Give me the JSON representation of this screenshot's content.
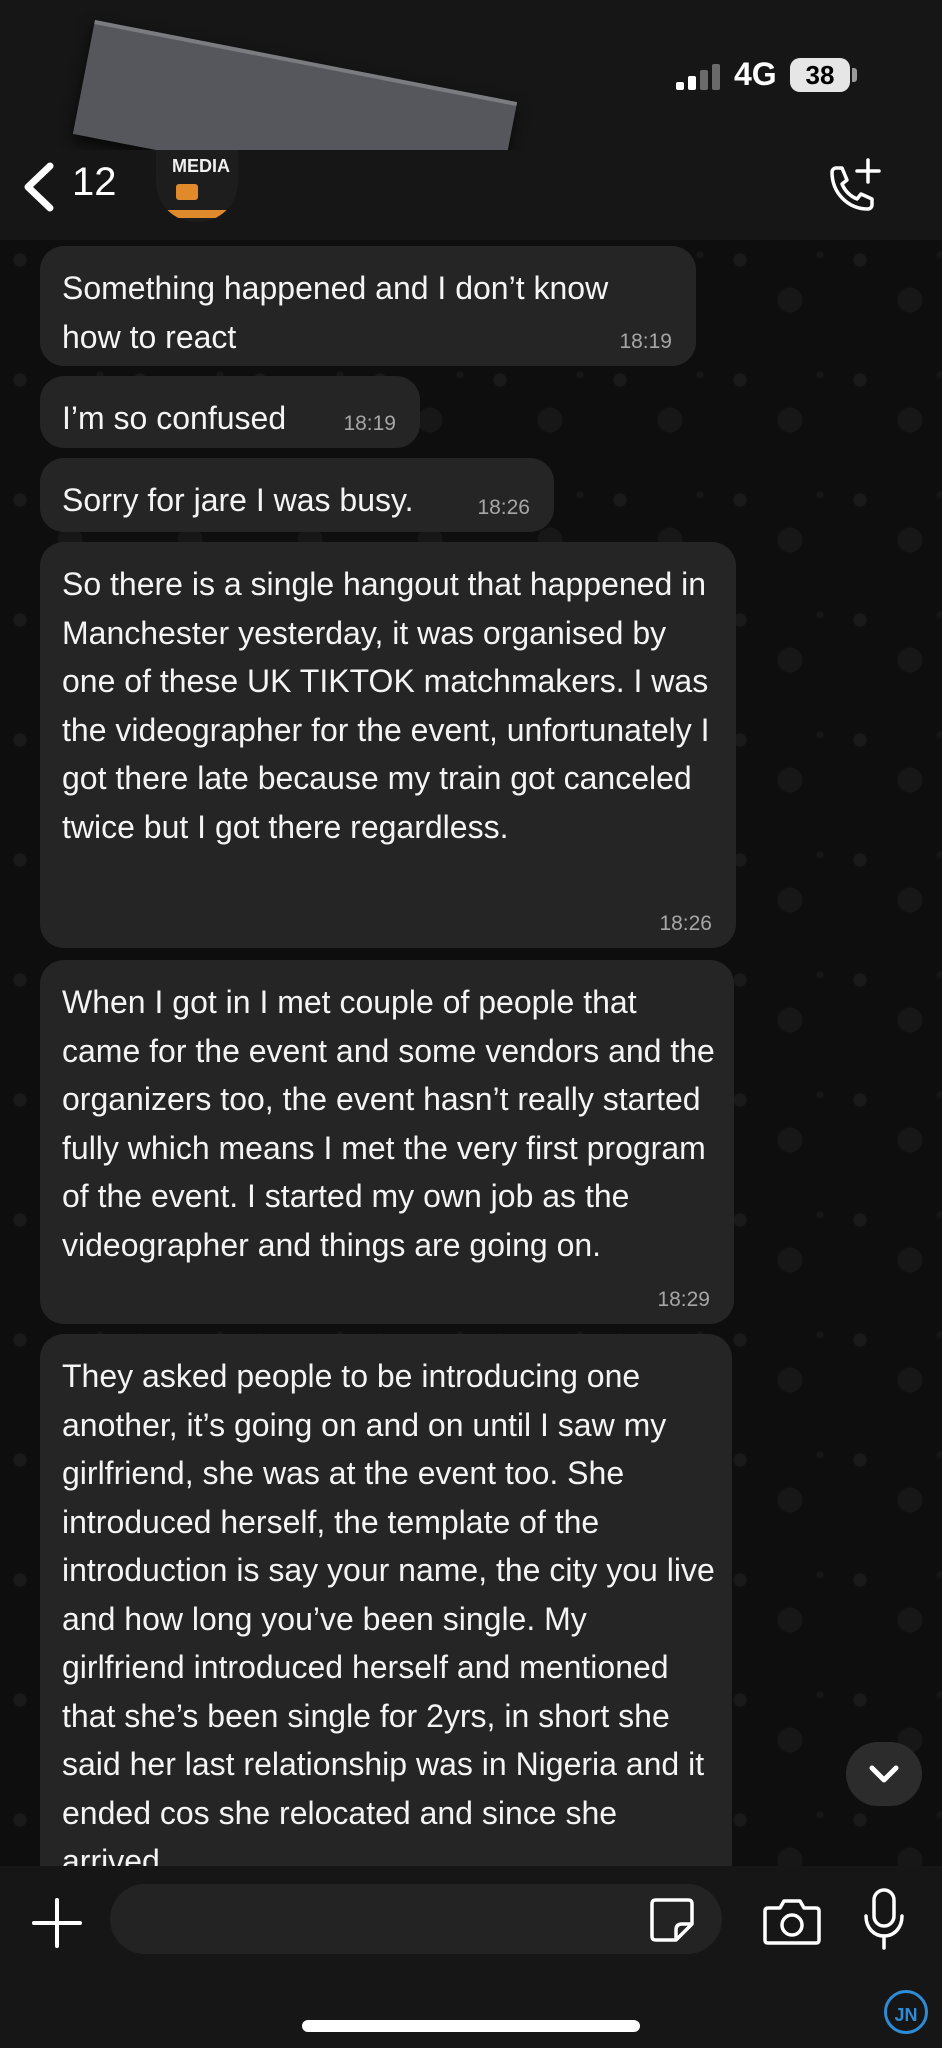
{
  "status_bar": {
    "network": "4G",
    "battery": "38"
  },
  "header": {
    "unread_count": "12",
    "avatar_text": "MEDIA"
  },
  "messages": [
    {
      "text": "Something happened and I don’t know how to react",
      "time": "18:19"
    },
    {
      "text": "I’m so confused",
      "time": "18:19"
    },
    {
      "text": "Sorry for jare I was busy.",
      "time": "18:26"
    },
    {
      "text": "So there is a single hangout that happened in Manchester yesterday, it was organised by one of these UK TIKTOK matchmakers. I was the videographer for the event, unfortunately I got there late because my train got canceled twice but I got there regardless.",
      "time": "18:26"
    },
    {
      "text": "When I got in I met couple of people that came for the event and some vendors and the organizers too, the event hasn’t really started fully which means I met the very first program of the event. I started my own job as the  videographer and things are going on.",
      "time": "18:29"
    },
    {
      "text": "They asked people to be introducing one another, it’s going on and on until I saw my girlfriend, she was at the event too. She introduced herself, the template of the introduction is say your name, the city you live and how long you’ve been single. My girlfriend introduced herself and mentioned that she’s been single for 2yrs, in short she said her last relationship was in Nigeria and it ended cos she relocated and since she arrived",
      "time": ""
    }
  ],
  "composer": {
    "placeholder": ""
  },
  "watermark": "JN",
  "icons": {
    "back": "chevron-left-icon",
    "call": "phone-plus-icon",
    "plus": "plus-icon",
    "sticker": "sticker-icon",
    "camera": "camera-icon",
    "mic": "microphone-icon",
    "scroll_down": "chevron-down-icon"
  },
  "colors": {
    "bubble": "#252525",
    "background": "#0e0e0e",
    "bars": "#161616"
  }
}
